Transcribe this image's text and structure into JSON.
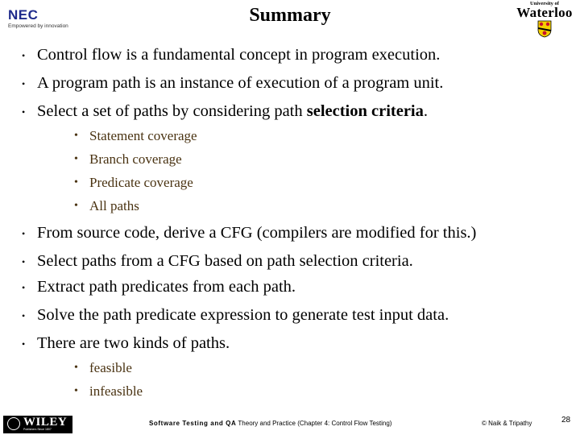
{
  "header": {
    "title": "Summary",
    "left_logo": {
      "brand": "NEC",
      "tagline": "Empowered by innovation",
      "brand_color": "#1f2b8c"
    },
    "right_logo": {
      "small": "University of",
      "big": "Waterloo",
      "crest_colors": [
        "#f4d000",
        "#c8102e",
        "#000000"
      ]
    }
  },
  "content": {
    "bullets_top": [
      {
        "text": "Control flow is a fundamental concept in program execution."
      },
      {
        "text": "A program path is an instance of execution of a program unit."
      },
      {
        "text_before": "Select a set of paths by considering path ",
        "text_bold": "selection criteria",
        "text_after": "."
      }
    ],
    "criteria": [
      "Statement coverage",
      "Branch coverage",
      "Predicate coverage",
      "All paths"
    ],
    "bullets_bottom": [
      "From source code, derive a CFG (compilers are modified for this.)",
      "Select paths from a CFG based on path selection criteria.",
      "Extract path predicates from each path.",
      "Solve the path predicate expression to generate test input data.",
      "There are two kinds of paths."
    ],
    "path_kinds": [
      "feasible",
      "infeasible"
    ],
    "bullet_glyph": "•",
    "sub_color": "#4a3312"
  },
  "footer": {
    "publisher": {
      "word": "WILEY",
      "sub": "Publishers Since 1807"
    },
    "book_bold": "Software Testing and QA",
    "book_rest": " Theory and Practice (Chapter 4: Control Flow Testing)",
    "copyright": "© Naik & Tripathy",
    "page_number": "28"
  }
}
